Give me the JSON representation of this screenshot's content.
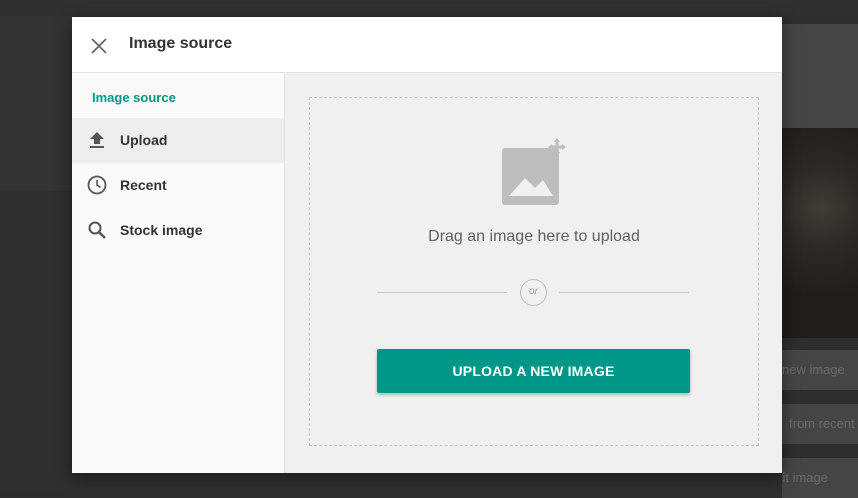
{
  "dialog": {
    "title": "Image source",
    "close_icon": "close-icon"
  },
  "sidebar": {
    "heading": "Image source",
    "items": [
      {
        "label": "Upload",
        "icon": "upload-icon",
        "active": true
      },
      {
        "label": "Recent",
        "icon": "clock-icon",
        "active": false
      },
      {
        "label": "Stock image",
        "icon": "search-icon",
        "active": false
      }
    ]
  },
  "dropzone": {
    "icon": "image-placeholder-icon",
    "instruction": "Drag an image here to upload",
    "or_label": "or",
    "upload_button": "UPLOAD A NEW IMAGE"
  },
  "background": {
    "buttons": [
      "new image",
      "from recent",
      "edit image"
    ]
  },
  "colors": {
    "accent": "#009688",
    "overlay": "#2e2e2e",
    "dialog_bg": "#f0f0f0"
  }
}
